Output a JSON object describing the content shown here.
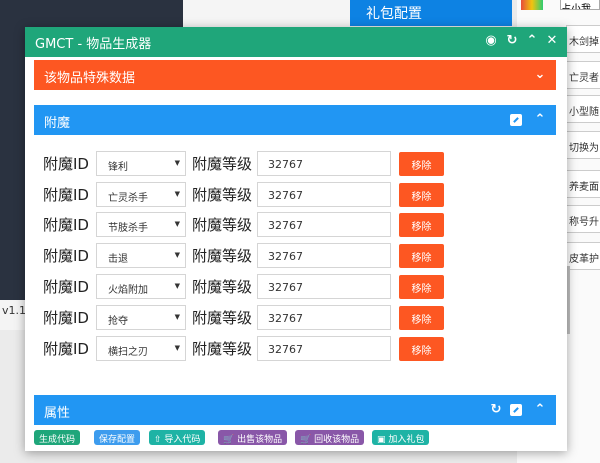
{
  "background": {
    "version": "v1.1",
    "gift_tab": "礼包配置",
    "top_box_text": "占小我",
    "right_items": [
      "木剑掉",
      "亡灵者",
      "小型随",
      "切换为",
      "养麦面",
      "称号升",
      "皮革护"
    ]
  },
  "dialog": {
    "title": "GMCT - 物品生成器",
    "title_icons": [
      "map-pin-icon",
      "refresh-icon",
      "collapse-icon",
      "close-icon"
    ]
  },
  "special_section": {
    "label": "该物品特殊数据"
  },
  "enchant_section": {
    "label": "附魔",
    "id_label": "附魔ID",
    "level_label": "附魔等级",
    "remove_label": "移除",
    "rows": [
      {
        "enchant": "锋利",
        "level": "32767"
      },
      {
        "enchant": "亡灵杀手",
        "level": "32767"
      },
      {
        "enchant": "节肢杀手",
        "level": "32767"
      },
      {
        "enchant": "击退",
        "level": "32767"
      },
      {
        "enchant": "火焰附加",
        "level": "32767"
      },
      {
        "enchant": "抢夺",
        "level": "32767"
      },
      {
        "enchant": "横扫之刃",
        "level": "32767"
      }
    ]
  },
  "attribute_section": {
    "label": "属性"
  },
  "footer": {
    "generate": "生成代码",
    "save": "保存配置",
    "import": "导入代码",
    "sell": "出售该物品",
    "recycle": "回收该物品",
    "add_gift": "加入礼包"
  },
  "colors": {
    "title_green": "#1fa67a",
    "orange": "#fd5722",
    "blue": "#2196f3",
    "purple": "#8957a8",
    "teal": "#1eb3a5"
  }
}
